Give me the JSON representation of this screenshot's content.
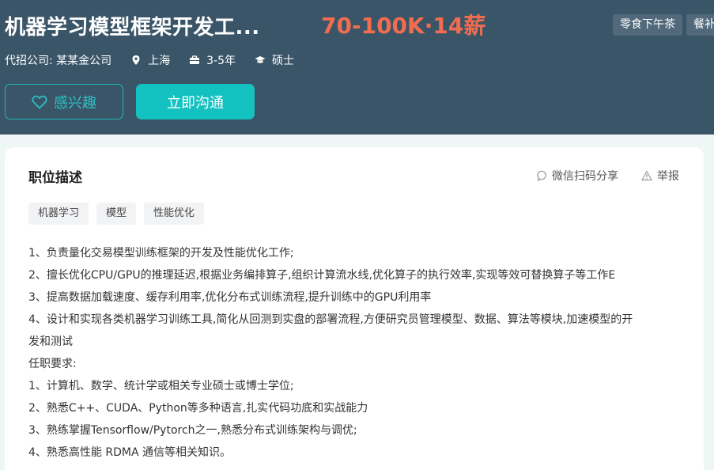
{
  "header": {
    "title": "机器学习模型框架开发工...",
    "salary": "70-100K·14薪",
    "welfare_tags": [
      "零食下午茶",
      "餐补"
    ],
    "company_label": "代招公司: 某某金公司",
    "location": "上海",
    "experience": "3-5年",
    "degree": "硕士",
    "buttons": {
      "interest": "感兴趣",
      "chat": "立即沟通"
    }
  },
  "card": {
    "title": "职位描述",
    "share_label": "微信扫码分享",
    "report_label": "举报",
    "tags": [
      "机器学习",
      "模型",
      "性能优化"
    ],
    "description": [
      "1、负责量化交易模型训练框架的开发及性能优化工作;",
      "2、擅长优化CPU/GPU的推理延迟,根据业务编排算子,组织计算流水线,优化算子的执行效率,实现等效可替换算子等工作E",
      "3、提高数据加载速度、缓存利用率,优化分布式训练流程,提升训练中的GPU利用率",
      "4、设计和实现各类机器学习训练工具,简化从回测到实盘的部署流程,方便研究员管理模型、数据、算法等模块,加速模型的开",
      "发和测试",
      "任职要求:",
      "1、计算机、数学、统计学或相关专业硕士或博士学位;",
      "2、熟悉C++、CUDA、Python等多种语言,扎实代码功底和实战能力",
      "3、熟练掌握Tensorflow/Pytorch之一,熟悉分布式训练架构与调优;",
      "4、熟悉高性能 RDMA 通信等相关知识。"
    ]
  },
  "colors": {
    "header_bg": "#3a5568",
    "salary": "#f26d4f",
    "accent": "#14c1c1"
  }
}
